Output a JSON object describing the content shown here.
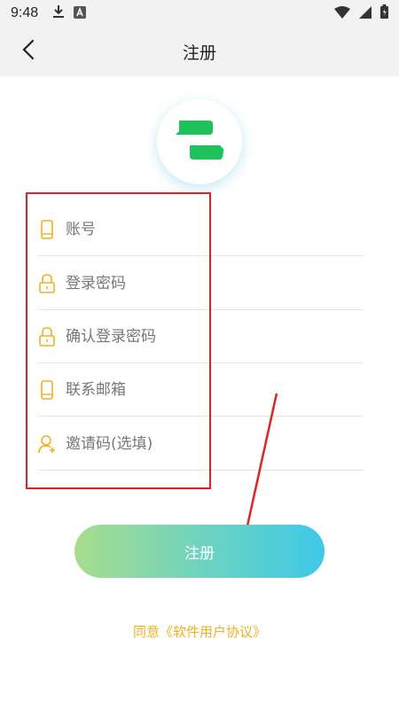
{
  "status_bar": {
    "time": "9:48",
    "icons": [
      "download-icon",
      "a-notification-icon",
      "wifi-icon",
      "signal-icon",
      "battery-icon"
    ]
  },
  "header": {
    "title": "注册",
    "back_icon": "back-chevron-icon"
  },
  "form": {
    "fields": [
      {
        "placeholder": "账号",
        "value": "",
        "icon": "phone-icon"
      },
      {
        "placeholder": "登录密码",
        "value": "",
        "icon": "lock-icon"
      },
      {
        "placeholder": "确认登录密码",
        "value": "",
        "icon": "lock-icon"
      },
      {
        "placeholder": "联系邮箱",
        "value": "",
        "icon": "phone-icon"
      },
      {
        "placeholder": "邀请码(选填)",
        "value": "",
        "icon": "add-user-icon"
      }
    ]
  },
  "register_button": {
    "label": "注册"
  },
  "agreement": {
    "text": "同意《软件用户协议》"
  },
  "colors": {
    "icon_accent": "#f0b020",
    "button_gradient_start": "#a8dd8c",
    "button_gradient_end": "#3ec9e8",
    "highlight_border": "#e62020",
    "logo_green": "#1fc25a"
  }
}
